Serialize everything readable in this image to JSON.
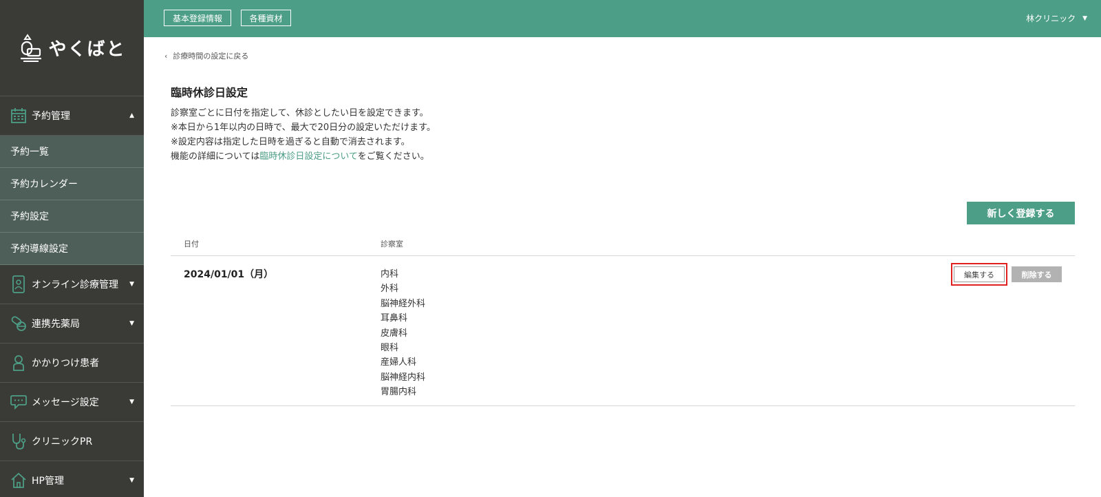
{
  "brand": {
    "name": "やくばと"
  },
  "header": {
    "buttons": [
      "基本登録情報",
      "各種資材"
    ],
    "clinic_name": "林クリニック"
  },
  "sidebar": {
    "groups": [
      {
        "label": "予約管理",
        "icon": "calendar-icon",
        "expanded": true
      },
      {
        "label": "オンライン診療管理",
        "icon": "smartphone-doctor-icon"
      },
      {
        "label": "連携先薬局",
        "icon": "pills-icon"
      },
      {
        "label": "かかりつけ患者",
        "icon": "person-icon"
      },
      {
        "label": "メッセージ設定",
        "icon": "chat-bubble-icon"
      },
      {
        "label": "クリニックPR",
        "icon": "stethoscope-icon"
      },
      {
        "label": "HP管理",
        "icon": "home-icon"
      }
    ],
    "sub_items": [
      "予約一覧",
      "予約カレンダー",
      "予約設定",
      "予約導線設定"
    ]
  },
  "main": {
    "back_link": "診療時間の設定に戻る",
    "title": "臨時休診日設定",
    "desc": {
      "line1": "診察室ごとに日付を指定して、休診としたい日を設定できます。",
      "line2": "※本日から1年以内の日時で、最大で20日分の設定いただけます。",
      "line3": "※設定内容は指定した日時を過ぎると自動で消去されます。",
      "line4_pre": "機能の詳細については",
      "line4_link": "臨時休診日設定について",
      "line4_post": "をご覧ください。"
    },
    "new_button": "新しく登録する",
    "table": {
      "headers": {
        "date": "日付",
        "room": "診察室"
      },
      "rows": [
        {
          "date": "2024/01/01（月）",
          "rooms": [
            "内科",
            "外科",
            "脳神経外科",
            "耳鼻科",
            "皮膚科",
            "眼科",
            "産婦人科",
            "脳神経内科",
            "胃腸内科"
          ],
          "edit_label": "編集する",
          "delete_label": "削除する"
        }
      ]
    }
  },
  "colors": {
    "accent": "#4d9e86",
    "sidebar": "#3a3a36",
    "submenu": "#4e5e58",
    "highlight": "#e02020"
  }
}
